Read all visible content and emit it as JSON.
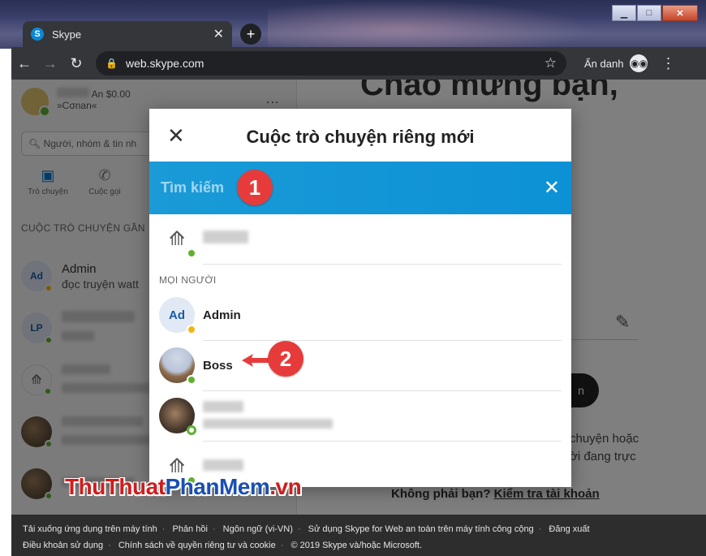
{
  "browser": {
    "tab_title": "Skype",
    "tab_favicon": "S",
    "url": "web.skype.com",
    "incognito_label": "Ẩn danh",
    "icons": [
      "back-arrow-icon",
      "forward-arrow-icon",
      "reload-icon",
      "lock-icon",
      "star-icon",
      "incognito-icon",
      "menu-dots-icon"
    ]
  },
  "sidebar": {
    "profile_name_suffix": "An",
    "profile_balance": "$0.00",
    "profile_mood": "»Cσnan«",
    "more_label": "...",
    "search_placeholder": "Người, nhóm & tin nh",
    "tabs": [
      {
        "label": "Trò chuyện",
        "icon": "chat-icon"
      },
      {
        "label": "Cuộc gọi",
        "icon": "phone-icon"
      }
    ],
    "section_label": "CUỘC TRÒ CHUYỆN GẦN",
    "recent": [
      {
        "initials": "Ad",
        "name": "Admin",
        "preview": "đọc truyện watt",
        "status": "away"
      },
      {
        "initials": "LP",
        "name": "",
        "preview": "",
        "status": "online"
      },
      {
        "initials": "",
        "name": "",
        "preview": "",
        "status": "online"
      },
      {
        "initials": "",
        "name": "",
        "preview": "",
        "status": "online"
      },
      {
        "initials": "",
        "name": "",
        "preview": "",
        "status": "online"
      }
    ]
  },
  "main": {
    "title_partial": "Chào mừng bạn,",
    "pill_label": "n",
    "text_line1": "chuyện hoặc",
    "text_line2": "ời đang trực",
    "not_you_label": "Không phải bạn?",
    "check_account_link": "Kiểm tra tài khoản"
  },
  "modal": {
    "title": "Cuộc trò chuyện riêng mới",
    "search_placeholder": "Tìm kiếm",
    "group_label": "MỌI NGƯỜI",
    "people": [
      {
        "name": "Admin",
        "initials": "Ad",
        "status": "away"
      },
      {
        "name": "Boss",
        "initials": "",
        "status": "online"
      }
    ]
  },
  "annotations": {
    "badge_1": "1",
    "badge_2": "2",
    "accent": "#e73b3b"
  },
  "footer": {
    "line1": [
      "Tải xuống ứng dụng trên máy tính",
      "Phản hồi",
      "Ngôn ngữ (vi-VN)",
      "Sử dụng Skype for Web an toàn trên máy tính công cộng",
      "Đăng xuất"
    ],
    "line2": [
      "Điều khoản sử dụng",
      "Chính sách về quyền riêng tư và cookie",
      "© 2019 Skype và/hoặc Microsoft."
    ]
  },
  "watermark": {
    "part1": "ThuThuat",
    "part2": "PhanMem",
    "part3": ".vn"
  },
  "colors": {
    "skype_blue": "#0b87d8",
    "search_bar": "#1a9bd7",
    "online": "#5eb130",
    "away": "#f1b51c"
  }
}
